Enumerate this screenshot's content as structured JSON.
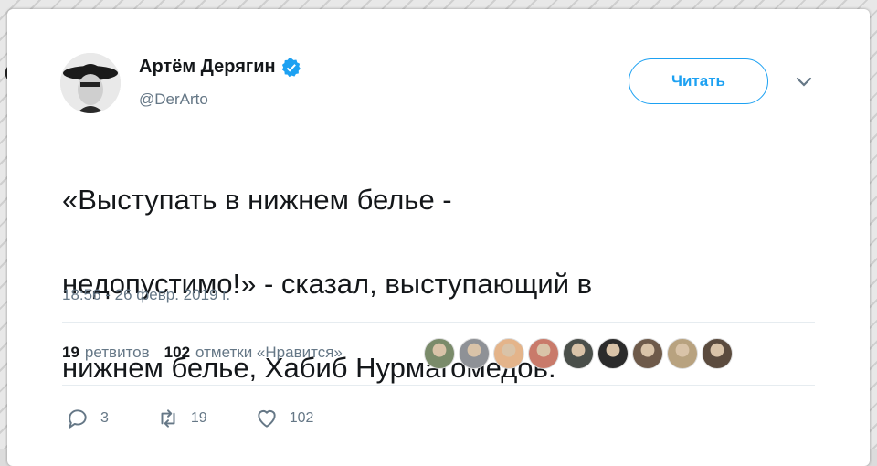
{
  "tweet": {
    "author_name": "Артём Дерягин",
    "handle": "@DerArto",
    "follow_label": "Читать",
    "text_lines": [
      "«Выступать в нижнем белье -",
      "недопустимо!» - сказал, выступающий в",
      "нижнем белье, Хабиб Нурмагомедов."
    ],
    "timestamp": "18:56 - 26 февр. 2019 г.",
    "stats": {
      "retweets_count": "19",
      "retweets_label": "ретвитов",
      "likes_count": "102",
      "likes_label": "отметки «Нравится»"
    },
    "liker_avatar_colors": [
      "#7a8b6a",
      "#8e9196",
      "#e4b48a",
      "#c97a6a",
      "#4a4f4a",
      "#2b2b2b",
      "#6e5a4a",
      "#b8a27f",
      "#5b4b3e"
    ],
    "actions": {
      "reply_count": "3",
      "retweet_count": "19",
      "like_count": "102"
    }
  },
  "colors": {
    "accent": "#1da1f2",
    "text": "#14171a",
    "muted": "#657786"
  },
  "icons": [
    "verified-badge-icon",
    "chevron-down-icon",
    "reply-icon",
    "retweet-icon",
    "heart-icon"
  ]
}
